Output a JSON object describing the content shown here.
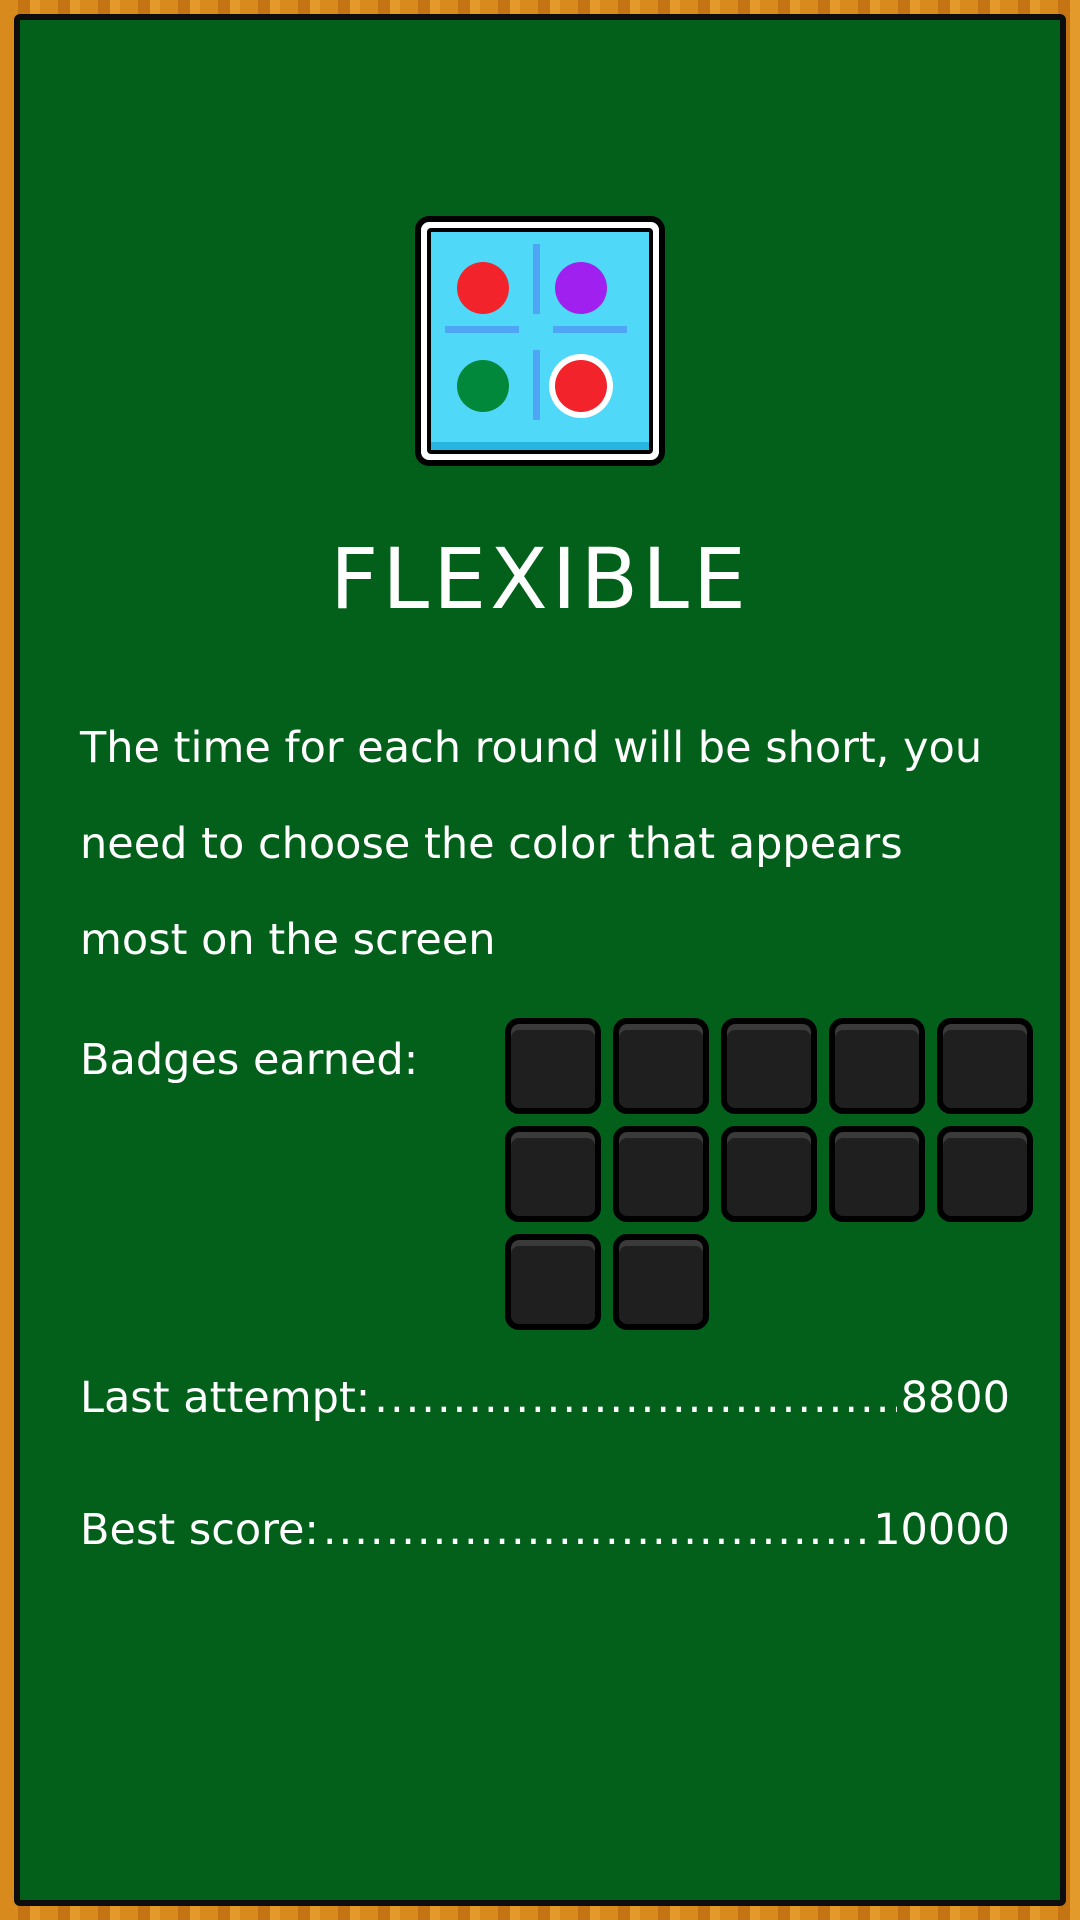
{
  "game": {
    "title": "FLEXIBLE",
    "description": "The time for each round will be short, you need to choose the color that appears most on the screen",
    "icon": {
      "name": "four-color-dots-icon",
      "dots": [
        {
          "color": "#f2232a",
          "selected": false
        },
        {
          "color": "#a020f0",
          "selected": false
        },
        {
          "color": "#02883a",
          "selected": false
        },
        {
          "color": "#f2232a",
          "selected": true
        }
      ]
    }
  },
  "badges": {
    "label": "Badges earned:",
    "total_slots": 12,
    "earned": 0
  },
  "stats": {
    "last_attempt_label": "Last attempt:",
    "last_attempt_value": "8800",
    "best_score_label": "Best score:",
    "best_score_value": "10000"
  },
  "colors": {
    "background": "#03601a",
    "frame": "#c97a12",
    "text": "#ffffff",
    "badge_slot": "#1f1f1f"
  }
}
